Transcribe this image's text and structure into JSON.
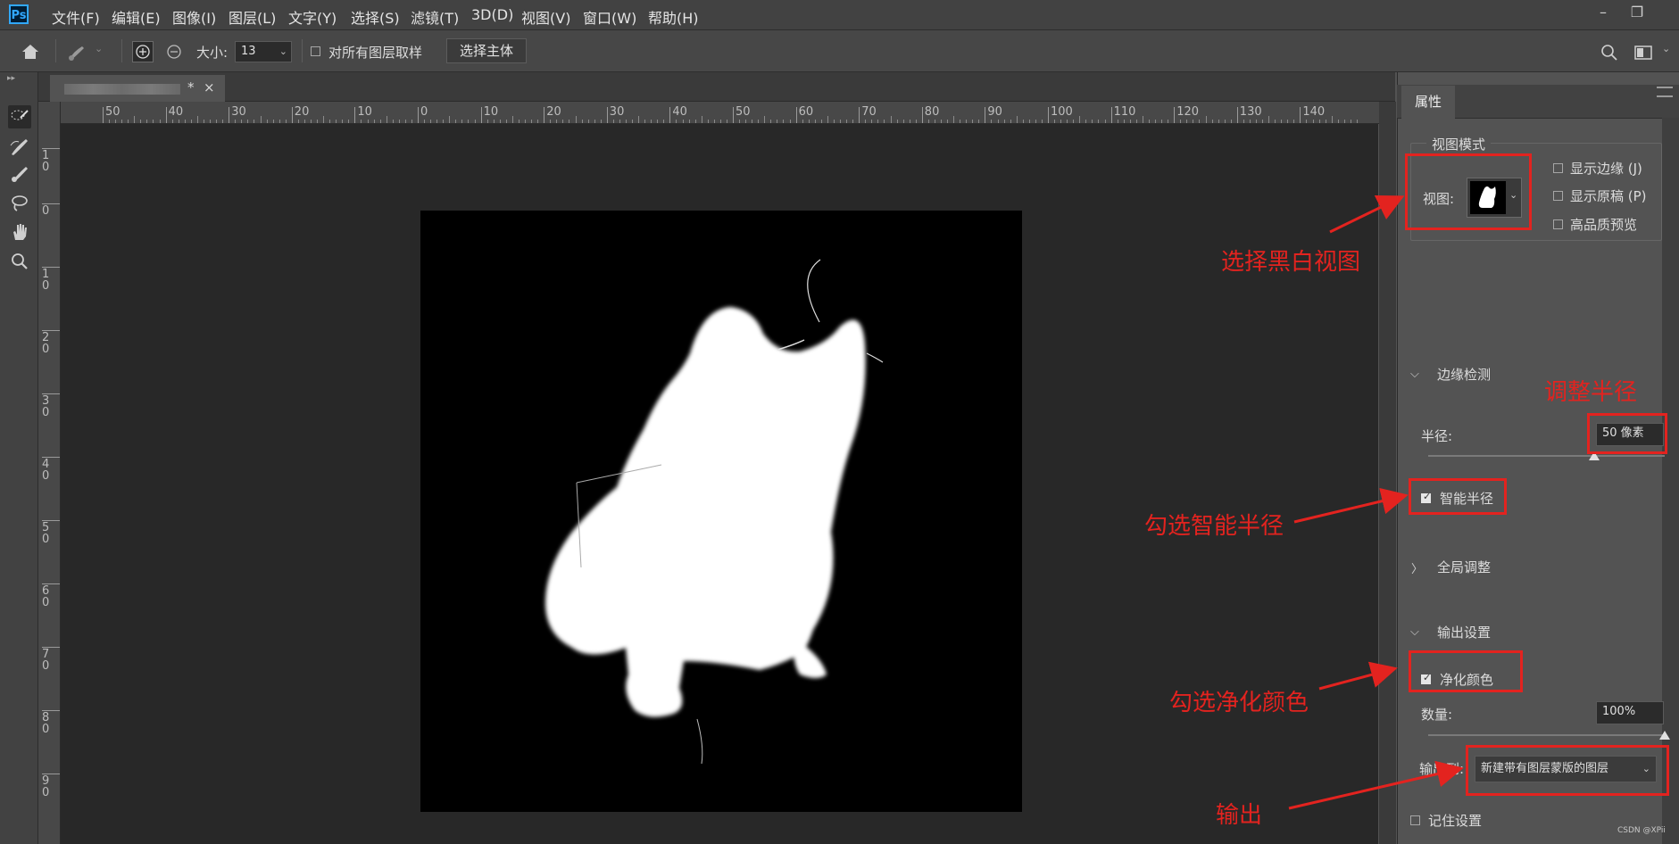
{
  "app": {
    "logo": "Ps"
  },
  "menu": [
    "文件(F)",
    "编辑(E)",
    "图像(I)",
    "图层(L)",
    "文字(Y)",
    "选择(S)",
    "滤镜(T)",
    "3D(D)",
    "视图(V)",
    "窗口(W)",
    "帮助(H)"
  ],
  "window_controls": {
    "minimize": "–",
    "restore": "❐"
  },
  "options_bar": {
    "size_label": "大小:",
    "size_value": "13",
    "sample_all_label": "对所有图层取样",
    "select_subject_label": "选择主体"
  },
  "document": {
    "tab_modified": "*",
    "tab_close": "×"
  },
  "ruler": {
    "h_ticks": [
      "50",
      "40",
      "30",
      "20",
      "10",
      "0",
      "10",
      "20",
      "30",
      "40",
      "50",
      "60",
      "70",
      "80",
      "90",
      "100",
      "110",
      "120",
      "130",
      "140"
    ],
    "v_ticks": [
      "1\n0",
      "0",
      "1\n0",
      "2\n0",
      "3\n0",
      "4\n0",
      "5\n0",
      "6\n0",
      "7\n0",
      "8\n0",
      "9\n0"
    ]
  },
  "properties": {
    "tab_label": "属性",
    "view_mode_title": "视图模式",
    "view_label": "视图:",
    "show_edge_label": "显示边缘 (J)",
    "show_original_label": "显示原稿 (P)",
    "hq_preview_label": "高品质预览",
    "edge_detection_title": "边缘检测",
    "radius_label": "半径:",
    "radius_value": "50 像素",
    "smart_radius_label": "智能半径",
    "global_refine_title": "全局调整",
    "output_settings_title": "输出设置",
    "decontaminate_label": "净化颜色",
    "amount_label": "数量:",
    "amount_value": "100%",
    "output_to_label": "输出到:",
    "output_to_value": "新建带有图层蒙版的图层",
    "remember_label": "记住设置",
    "radius_level": 0.7,
    "amount_level": 1.0,
    "smart_radius_checked": true,
    "decontaminate_checked": true
  },
  "annotations": {
    "select_bw_view": "选择黑白视图",
    "adjust_radius": "调整半径",
    "check_smart_radius": "勾选智能半径",
    "check_decontaminate": "勾选净化颜色",
    "output": "输出"
  },
  "watermark": "CSDN @XPii",
  "colors": {
    "annotation_red": "#e3231f",
    "canvas_bg": "#282828"
  }
}
